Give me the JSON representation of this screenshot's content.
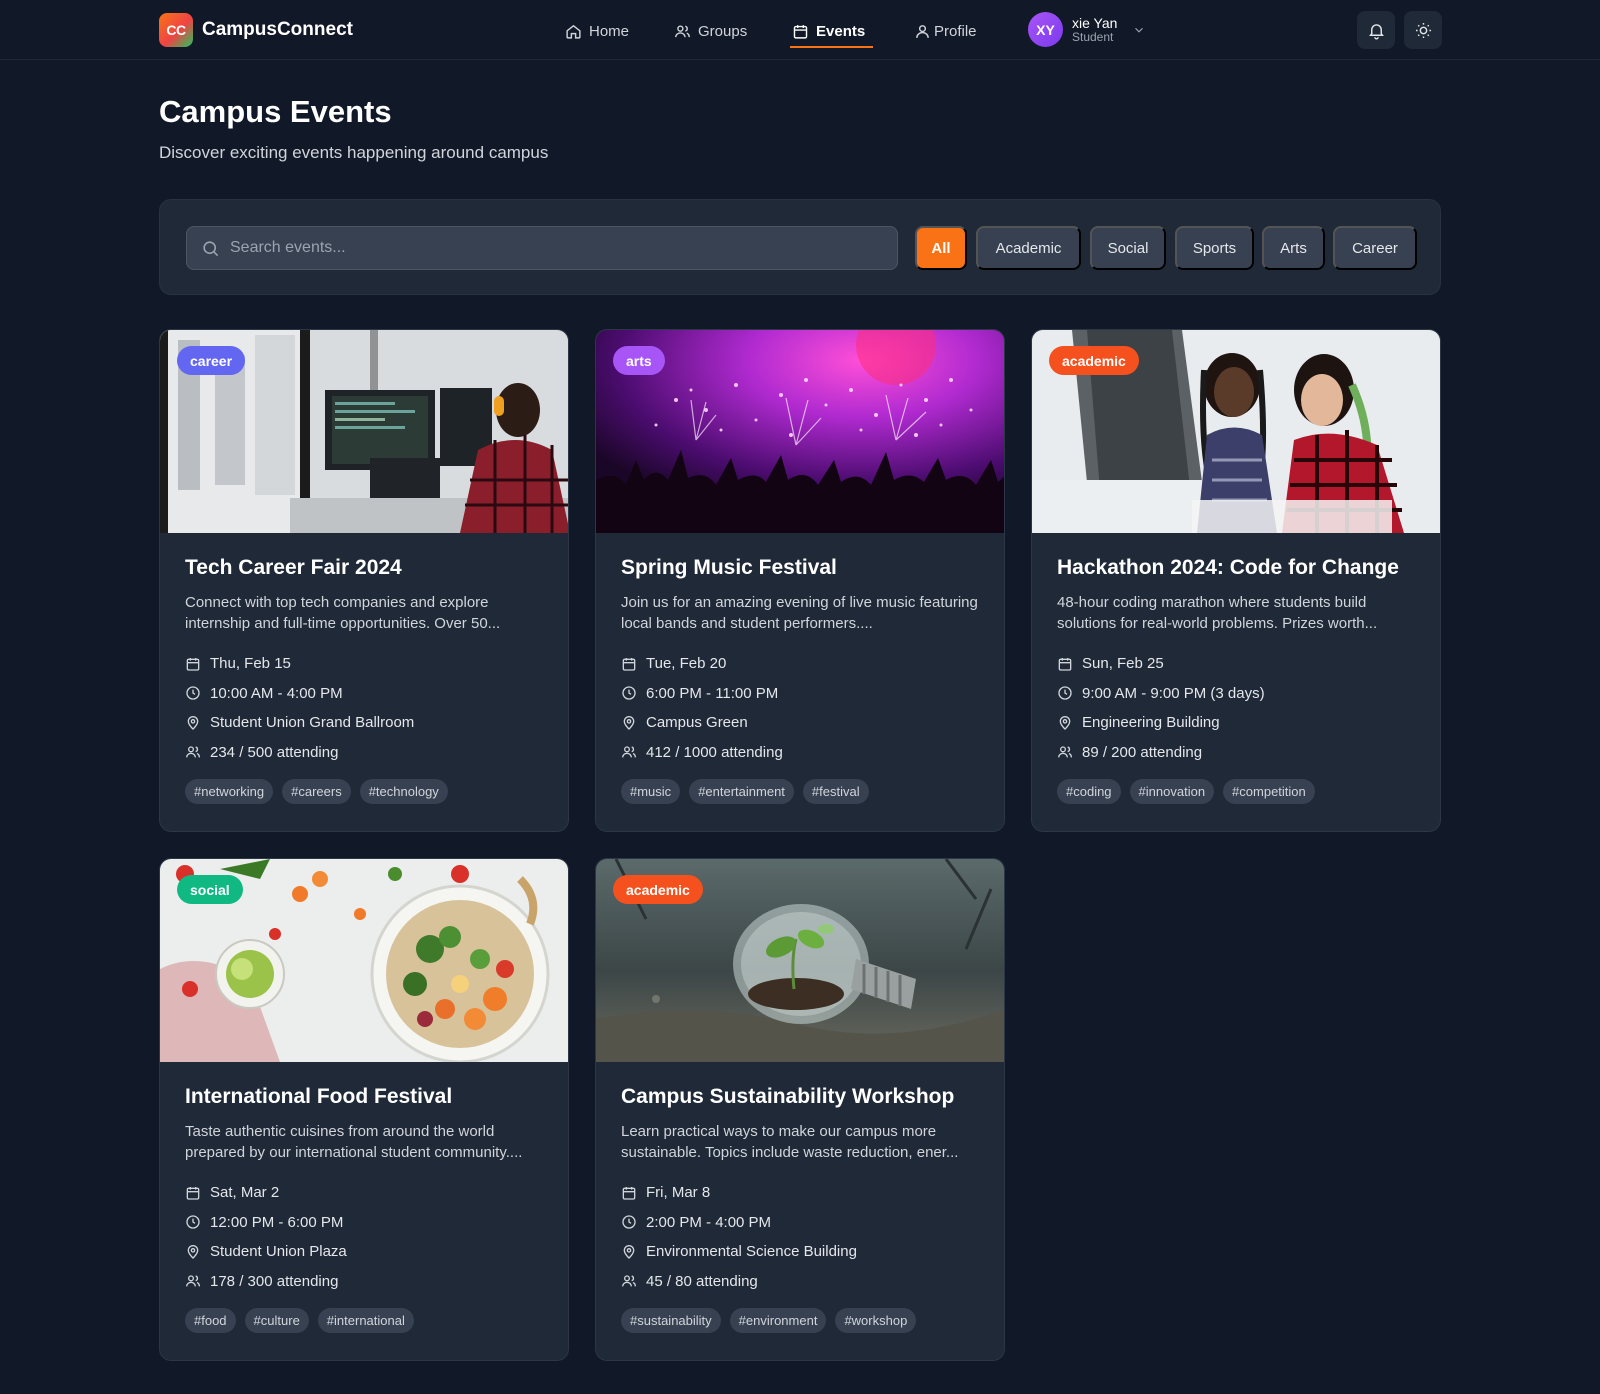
{
  "app": {
    "logo_text": "CC",
    "name": "CampusConnect"
  },
  "nav": [
    {
      "label": "Home",
      "icon": "home-icon",
      "active": false
    },
    {
      "label": "Groups",
      "icon": "users-icon",
      "active": false
    },
    {
      "label": "Events",
      "icon": "calendar-icon",
      "active": true
    },
    {
      "label": "Profile",
      "icon": "user-icon",
      "active": false
    }
  ],
  "user": {
    "initials": "XY",
    "name": "xie Yan",
    "role": "Student"
  },
  "header": {
    "title": "Campus Events",
    "subtitle": "Discover exciting events happening around campus"
  },
  "search": {
    "placeholder": "Search events...",
    "value": ""
  },
  "filters": [
    "All",
    "Academic",
    "Social",
    "Sports",
    "Arts",
    "Career"
  ],
  "active_filter": "All",
  "colors": {
    "accent": "#f97316",
    "career": "#6366f1",
    "arts": "#a855f7",
    "academic": "#f4511e",
    "social": "#10b981"
  },
  "events": [
    {
      "category": "career",
      "title": "Tech Career Fair 2024",
      "description": "Connect with top tech companies and explore internship and full-time opportunities. Over 50...",
      "date": "Thu, Feb 15",
      "time": "10:00 AM - 4:00 PM",
      "location": "Student Union Grand Ballroom",
      "attending": "234 / 500 attending",
      "tags": [
        "#networking",
        "#careers",
        "#technology"
      ]
    },
    {
      "category": "arts",
      "title": "Spring Music Festival",
      "description": "Join us for an amazing evening of live music featuring local bands and student performers....",
      "date": "Tue, Feb 20",
      "time": "6:00 PM - 11:00 PM",
      "location": "Campus Green",
      "attending": "412 / 1000 attending",
      "tags": [
        "#music",
        "#entertainment",
        "#festival"
      ]
    },
    {
      "category": "academic",
      "title": "Hackathon 2024: Code for Change",
      "description": "48-hour coding marathon where students build solutions for real-world problems. Prizes worth...",
      "date": "Sun, Feb 25",
      "time": "9:00 AM - 9:00 PM (3 days)",
      "location": "Engineering Building",
      "attending": "89 / 200 attending",
      "tags": [
        "#coding",
        "#innovation",
        "#competition"
      ]
    },
    {
      "category": "social",
      "title": "International Food Festival",
      "description": "Taste authentic cuisines from around the world prepared by our international student community....",
      "date": "Sat, Mar 2",
      "time": "12:00 PM - 6:00 PM",
      "location": "Student Union Plaza",
      "attending": "178 / 300 attending",
      "tags": [
        "#food",
        "#culture",
        "#international"
      ]
    },
    {
      "category": "academic",
      "title": "Campus Sustainability Workshop",
      "description": "Learn practical ways to make our campus more sustainable. Topics include waste reduction, ener...",
      "date": "Fri, Mar 8",
      "time": "2:00 PM - 4:00 PM",
      "location": "Environmental Science Building",
      "attending": "45 / 80 attending",
      "tags": [
        "#sustainability",
        "#environment",
        "#workshop"
      ]
    }
  ]
}
